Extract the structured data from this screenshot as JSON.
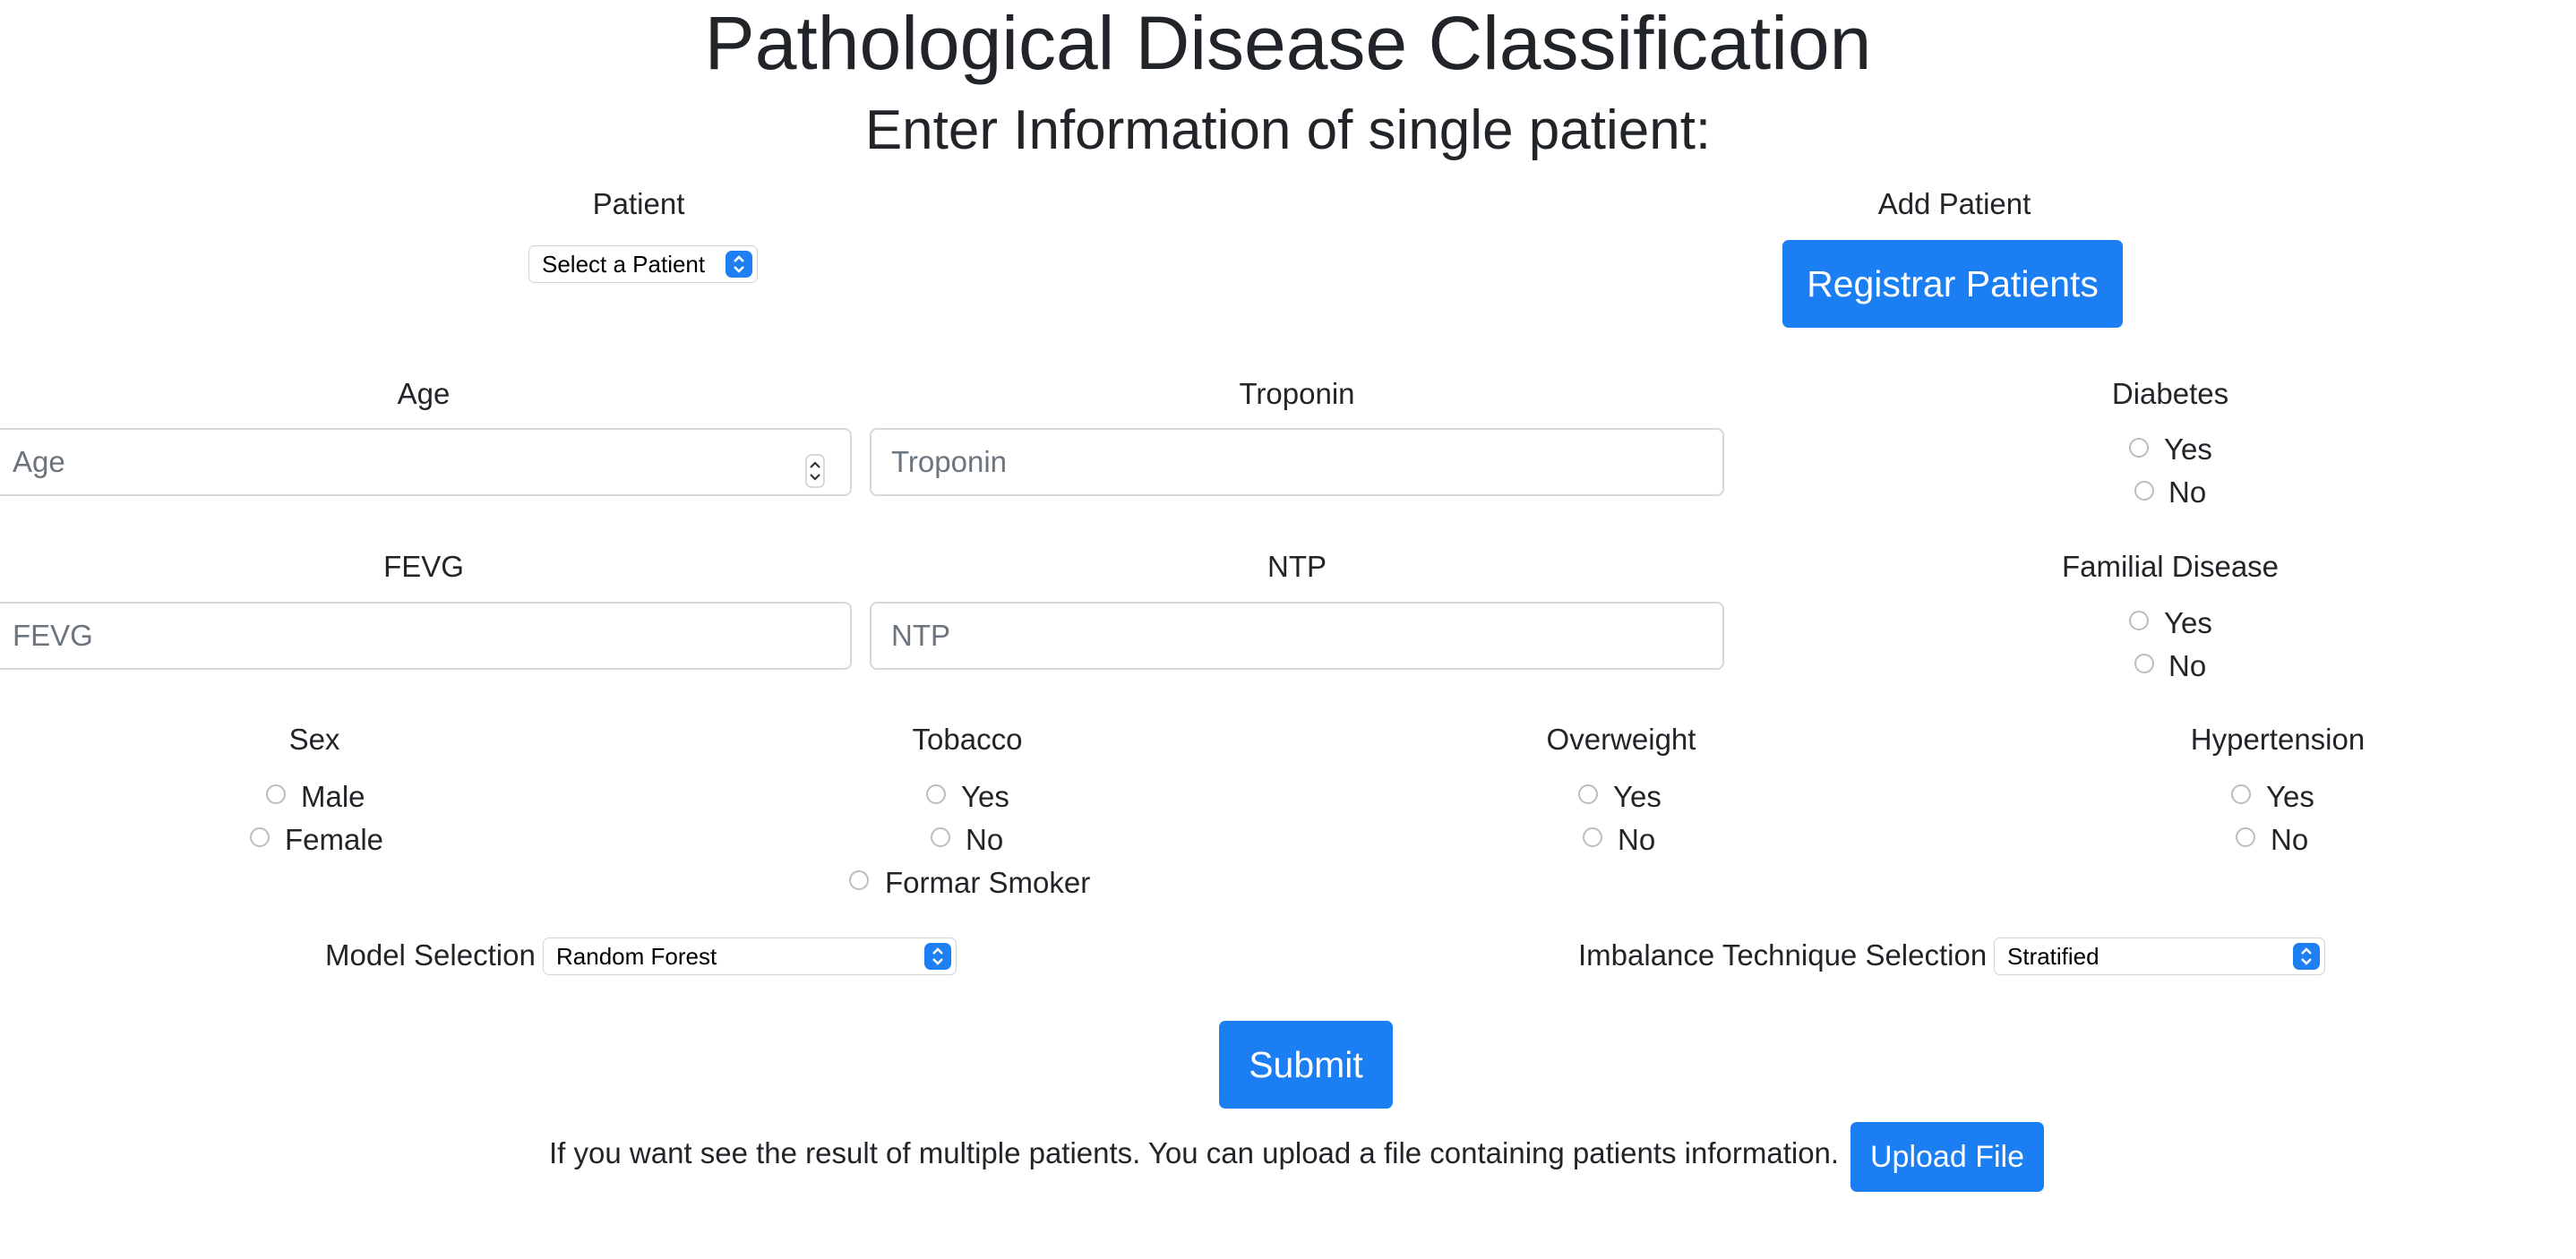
{
  "header": {
    "title": "Pathological Disease Classification",
    "subtitle": "Enter Information of single patient:"
  },
  "patient": {
    "label": "Patient",
    "select_value": "Select a Patient"
  },
  "add_patient": {
    "label": "Add Patient",
    "button": "Registrar Patients"
  },
  "fields": {
    "age": {
      "label": "Age",
      "placeholder": "Age"
    },
    "troponin": {
      "label": "Troponin",
      "placeholder": "Troponin"
    },
    "fevg": {
      "label": "FEVG",
      "placeholder": "FEVG"
    },
    "ntp": {
      "label": "NTP",
      "placeholder": "NTP"
    }
  },
  "diabetes": {
    "label": "Diabetes",
    "options": [
      "Yes",
      "No"
    ]
  },
  "familial": {
    "label": "Familial Disease",
    "options": [
      "Yes",
      "No"
    ]
  },
  "sex": {
    "label": "Sex",
    "options": [
      "Male",
      "Female"
    ]
  },
  "tobacco": {
    "label": "Tobacco",
    "options": [
      "Yes",
      "No",
      "Formar Smoker"
    ]
  },
  "overweight": {
    "label": "Overweight",
    "options": [
      "Yes",
      "No"
    ]
  },
  "hypertension": {
    "label": "Hypertension",
    "options": [
      "Yes",
      "No"
    ]
  },
  "model": {
    "label": "Model Selection",
    "value": "Random Forest"
  },
  "imbalance": {
    "label": "Imbalance Technique Selection",
    "value": "Stratified"
  },
  "submit": {
    "label": "Submit"
  },
  "upload": {
    "text": "If you want see the result of multiple patients. You can upload a file containing patients information.",
    "button": "Upload File"
  },
  "colors": {
    "accent": "#1b7ff3",
    "text": "#212529",
    "placeholder": "#6c757d"
  }
}
